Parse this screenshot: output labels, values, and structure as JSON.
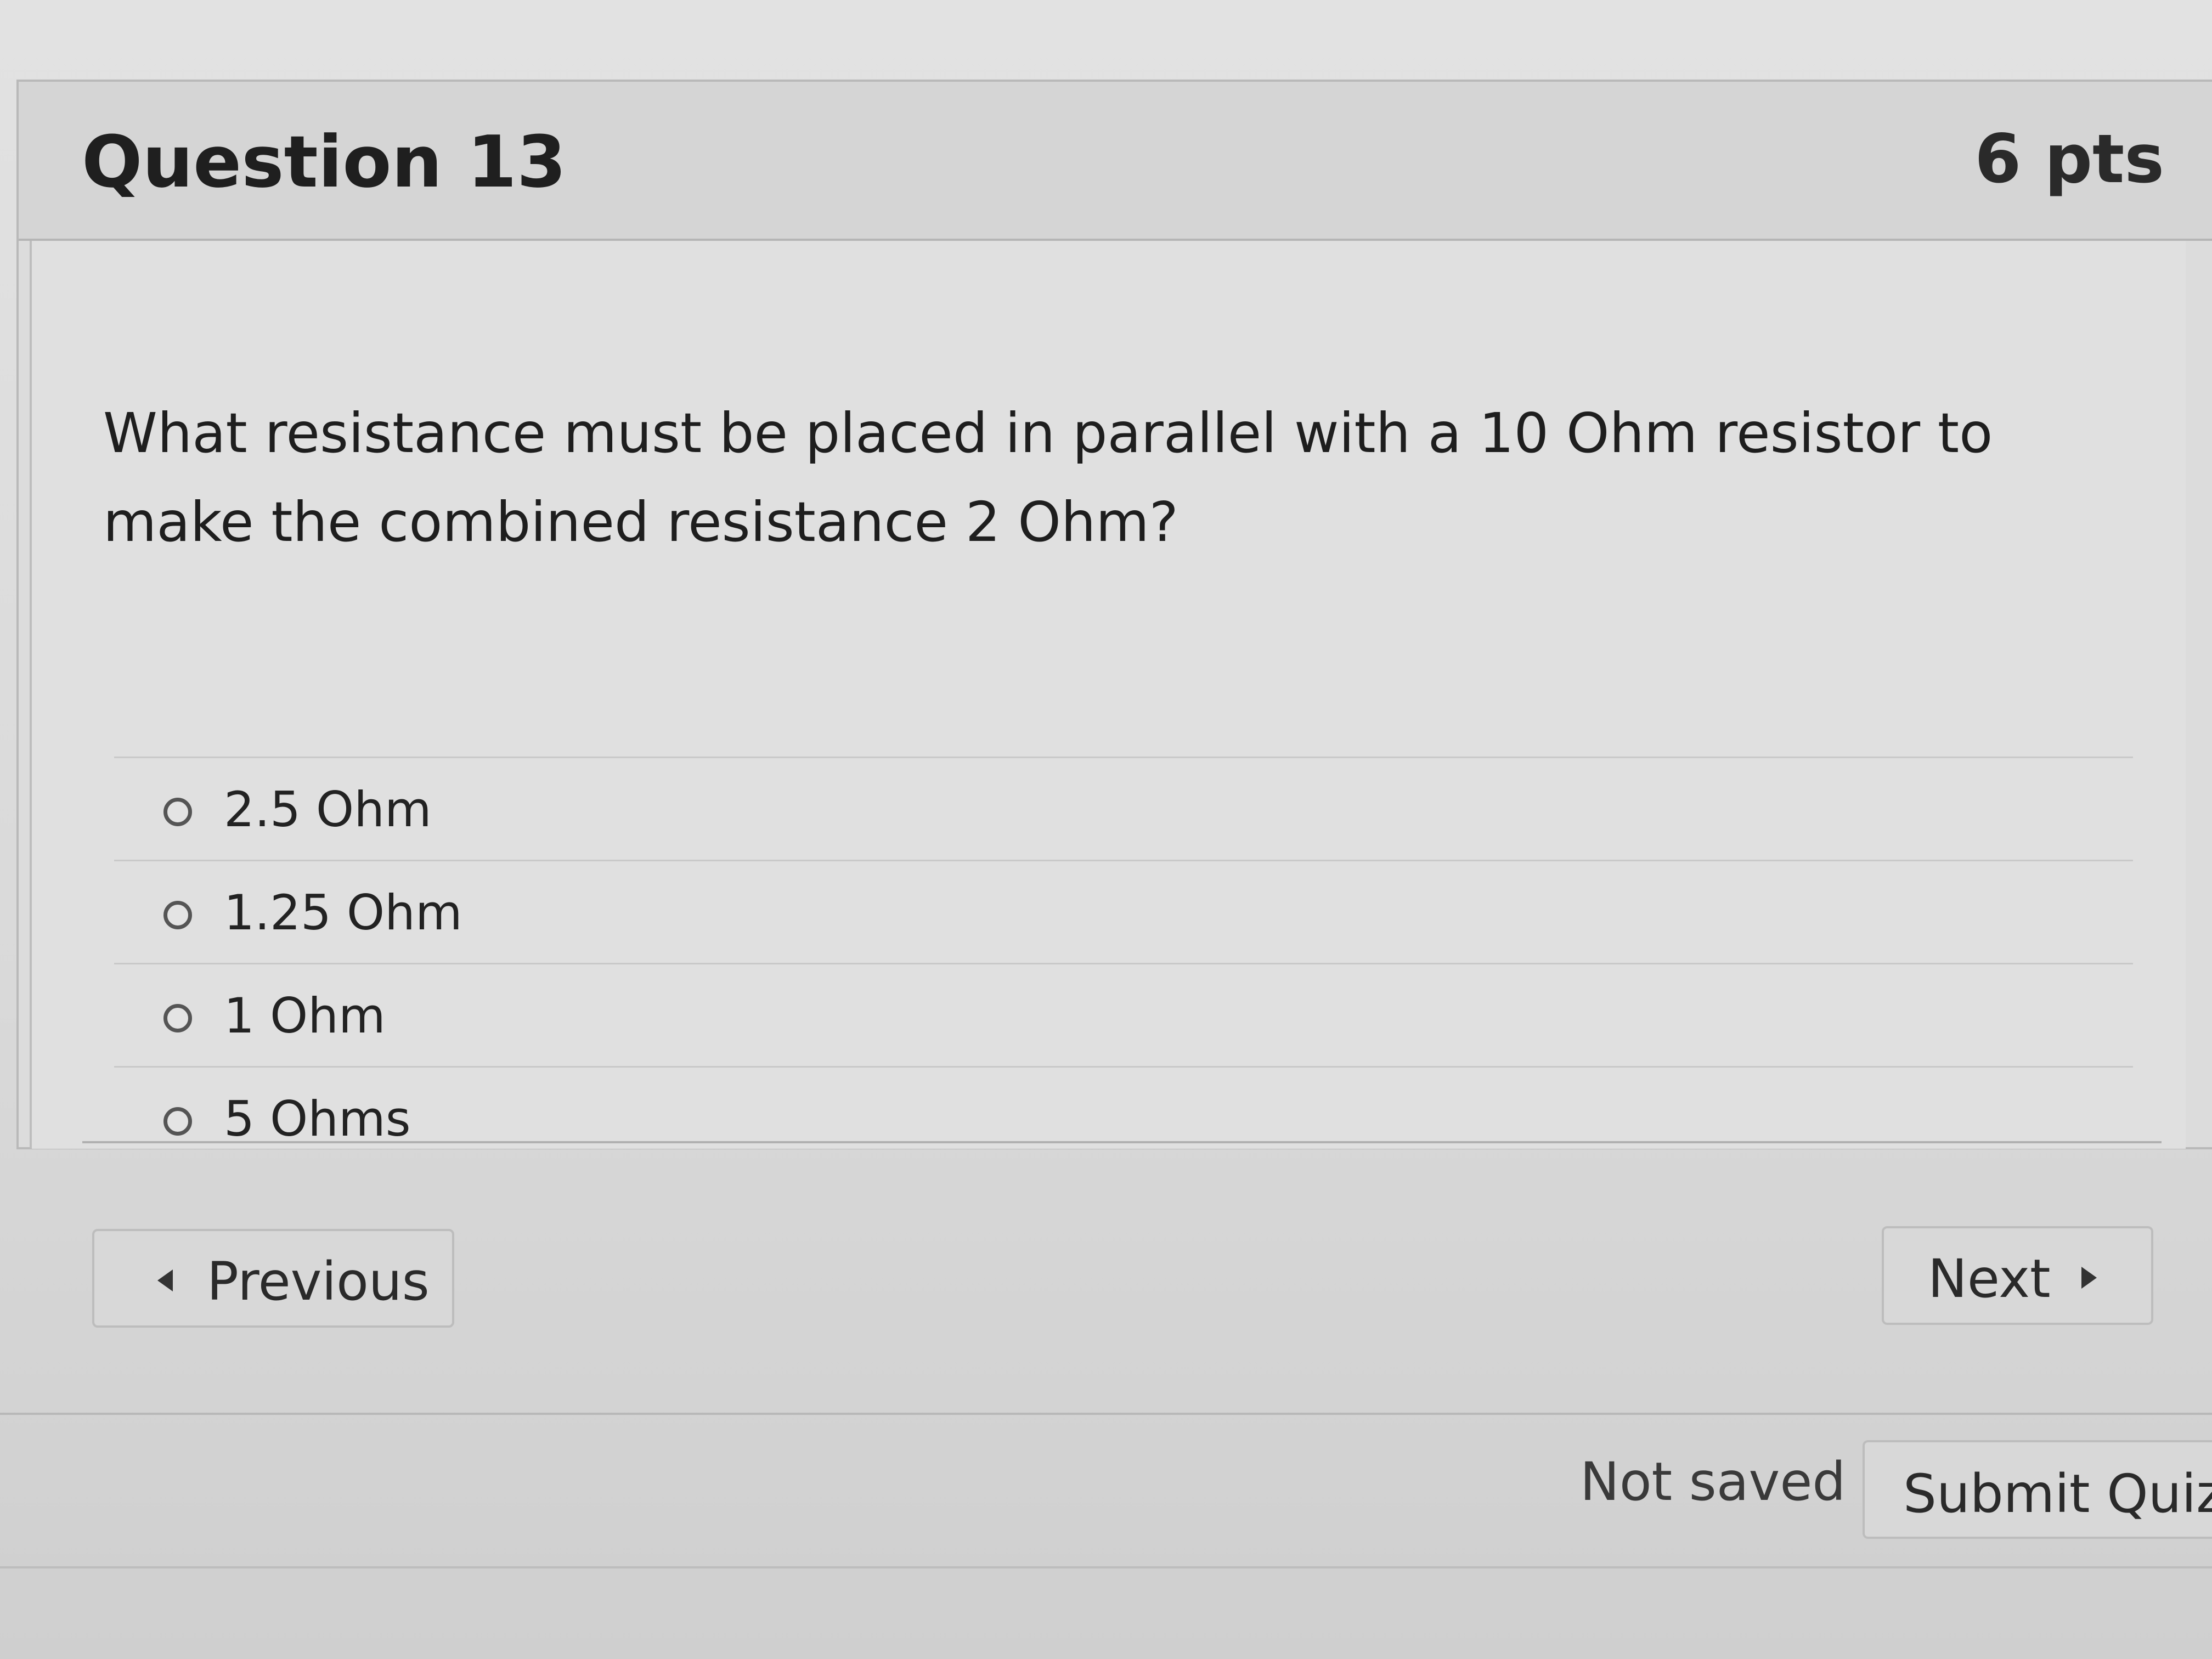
{
  "question": {
    "title": "Question 13",
    "points": "6 pts",
    "text": "What resistance must be placed in parallel with a 10 Ohm resistor to make the combined resistance 2 Ohm?",
    "answers": [
      {
        "label": "2.5 Ohm",
        "selected": false
      },
      {
        "label": "1.25 Ohm",
        "selected": false
      },
      {
        "label": "1 Ohm",
        "selected": false
      },
      {
        "label": "5 Ohms",
        "selected": false
      }
    ]
  },
  "navigation": {
    "previous_label": "Previous",
    "previous_icon": "triangle-left-icon",
    "next_label": "Next",
    "next_icon": "triangle-right-icon"
  },
  "footer": {
    "status": "Not saved",
    "submit_label": "Submit Quiz"
  },
  "colors": {
    "background": "#dedede",
    "text": "#1e1e1e",
    "border": "#b9b9b9"
  }
}
